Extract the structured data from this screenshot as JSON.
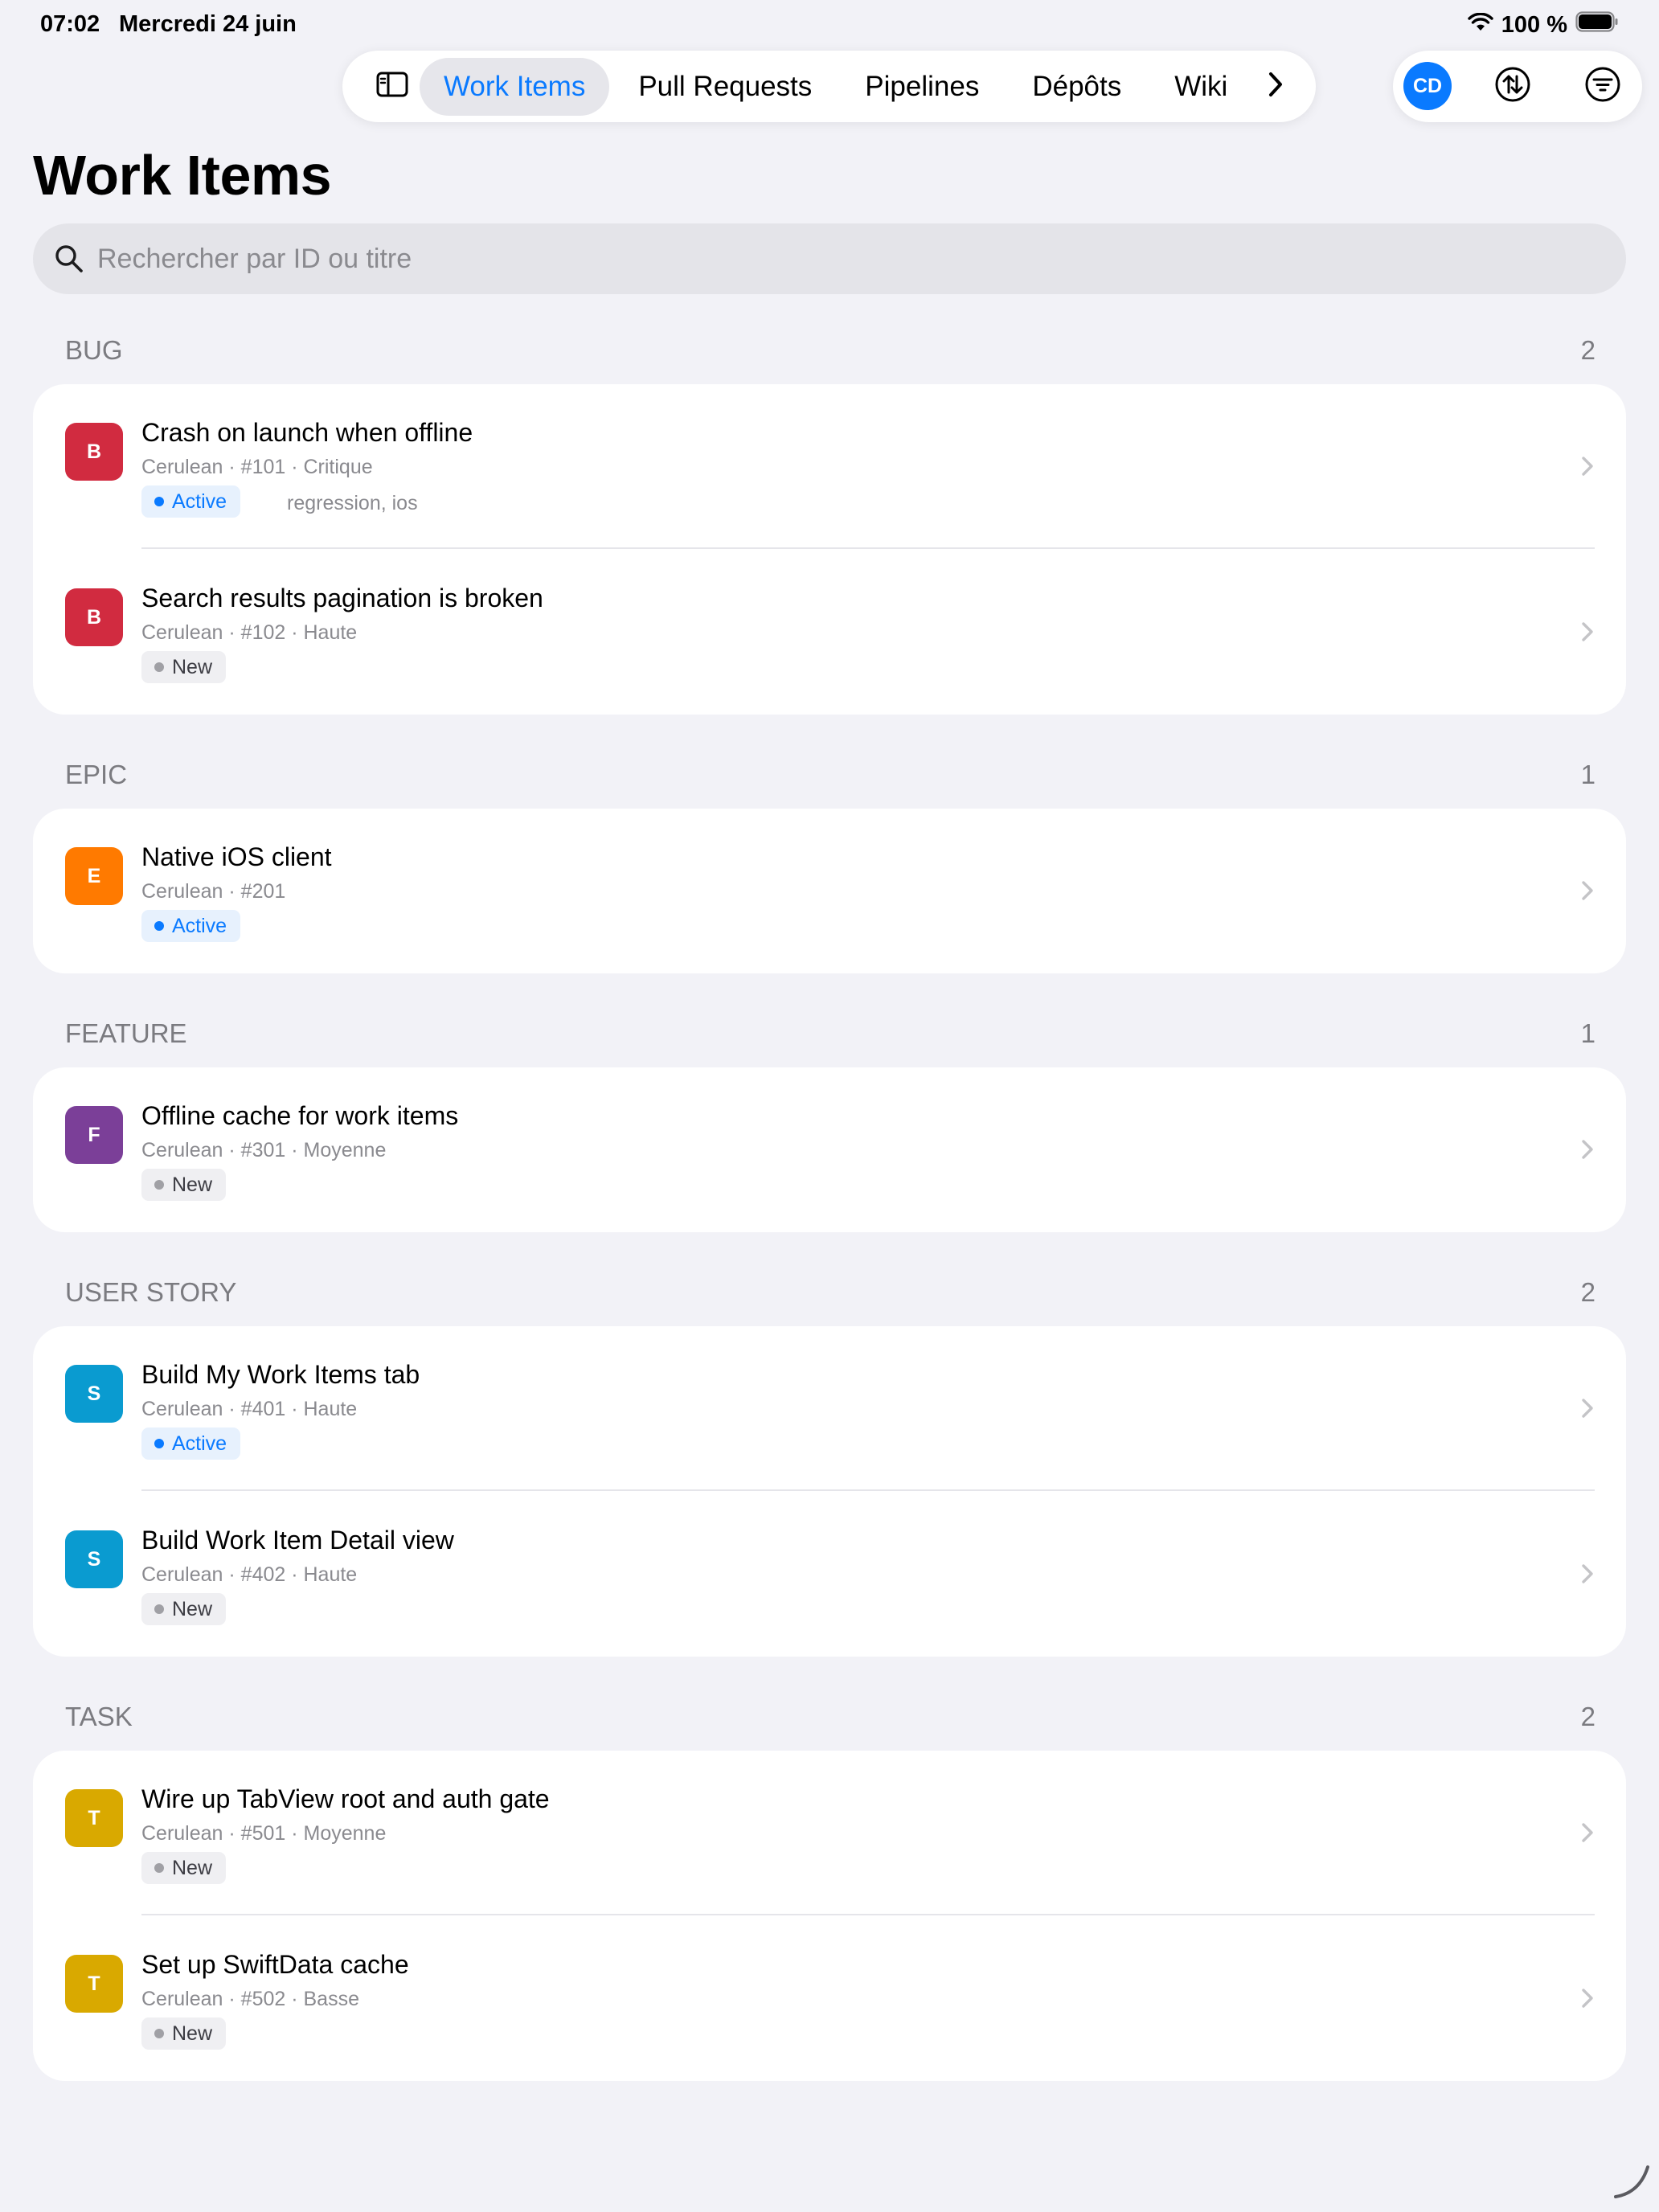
{
  "status_bar": {
    "time": "07:02",
    "date": "Mercredi 24 juin",
    "battery": "100 %"
  },
  "tabs": [
    {
      "label": "Work Items",
      "active": true
    },
    {
      "label": "Pull Requests",
      "active": false
    },
    {
      "label": "Pipelines",
      "active": false
    },
    {
      "label": "Dépôts",
      "active": false
    },
    {
      "label": "Wiki",
      "active": false
    }
  ],
  "actions": {
    "avatar_initials": "CD"
  },
  "page": {
    "title": "Work Items"
  },
  "search": {
    "placeholder": "Rechercher par ID ou titre",
    "value": ""
  },
  "sections": [
    {
      "name": "BUG",
      "count": "2",
      "items": [
        {
          "badge": "B",
          "badge_color": "#d12b40",
          "title": "Crash on launch when offline",
          "meta": "Cerulean · #101 · Critique",
          "state": "Active",
          "tags": "regression, ios"
        },
        {
          "badge": "B",
          "badge_color": "#d12b40",
          "title": "Search results pagination is broken",
          "meta": "Cerulean · #102 · Haute",
          "state": "New",
          "tags": ""
        }
      ]
    },
    {
      "name": "EPIC",
      "count": "1",
      "items": [
        {
          "badge": "E",
          "badge_color": "#ff7a00",
          "title": "Native iOS client",
          "meta": "Cerulean · #201",
          "state": "Active",
          "tags": ""
        }
      ]
    },
    {
      "name": "FEATURE",
      "count": "1",
      "items": [
        {
          "badge": "F",
          "badge_color": "#7b3f98",
          "title": "Offline cache for work items",
          "meta": "Cerulean · #301 · Moyenne",
          "state": "New",
          "tags": ""
        }
      ]
    },
    {
      "name": "USER STORY",
      "count": "2",
      "items": [
        {
          "badge": "S",
          "badge_color": "#0a9bd0",
          "title": "Build My Work Items tab",
          "meta": "Cerulean · #401 · Haute",
          "state": "Active",
          "tags": ""
        },
        {
          "badge": "S",
          "badge_color": "#0a9bd0",
          "title": "Build Work Item Detail view",
          "meta": "Cerulean · #402 · Haute",
          "state": "New",
          "tags": ""
        }
      ]
    },
    {
      "name": "TASK",
      "count": "2",
      "items": [
        {
          "badge": "T",
          "badge_color": "#d9a900",
          "title": "Wire up TabView root and auth gate",
          "meta": "Cerulean · #501 · Moyenne",
          "state": "New",
          "tags": ""
        },
        {
          "badge": "T",
          "badge_color": "#d9a900",
          "title": "Set up SwiftData cache",
          "meta": "Cerulean · #502 · Basse",
          "state": "New",
          "tags": ""
        }
      ]
    }
  ]
}
